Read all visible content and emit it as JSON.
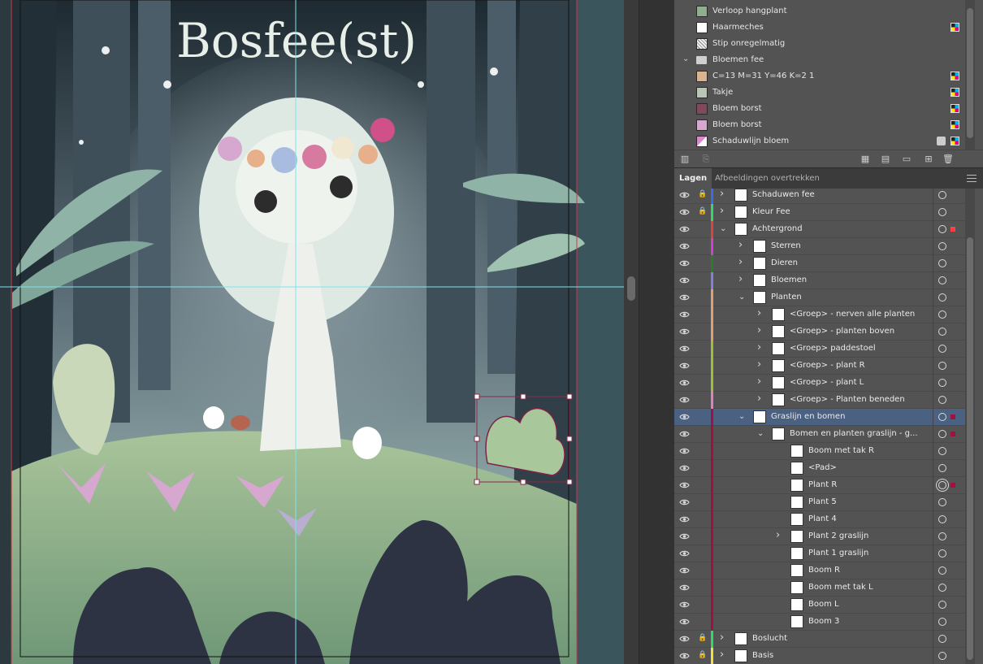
{
  "canvas": {
    "title_text": "Bosfee(st)"
  },
  "swatches": {
    "items": [
      {
        "label": "Verloop hangplant",
        "color": "#8fae8f",
        "kind": "swatch",
        "cmyk": false
      },
      {
        "label": "Haarmeches",
        "color": "#ffffff",
        "kind": "swatch",
        "cmyk": true
      },
      {
        "label": "Stip onregelmatig",
        "color": "#eeeeee",
        "kind": "pattern",
        "cmyk": false
      },
      {
        "label": "Bloemen fee",
        "kind": "folder"
      },
      {
        "label": "C=13 M=31 Y=46 K=2 1",
        "color": "#d9b48f",
        "kind": "swatch",
        "cmyk": true
      },
      {
        "label": "Takje",
        "color": "#b8c6b8",
        "kind": "swatch",
        "cmyk": true
      },
      {
        "label": "Bloem borst",
        "color": "#7d4b5c",
        "kind": "swatch",
        "cmyk": true
      },
      {
        "label": "Bloem borst",
        "color": "#d6a8d0",
        "kind": "swatch",
        "cmyk": true
      },
      {
        "label": "Schaduwlijn bloem",
        "color": "#d68cc6",
        "kind": "swatch",
        "cmyk": true
      }
    ]
  },
  "layers_panel": {
    "tabs": [
      "Lagen",
      "Afbeeldingen overtrekken"
    ],
    "rows": [
      {
        "label": "Schaduwen fee",
        "color": "#3b6de0",
        "indent": 0,
        "expand": "collapsed",
        "locked": true
      },
      {
        "label": "Kleur Fee",
        "color": "#2fd96a",
        "indent": 0,
        "expand": "collapsed",
        "locked": true
      },
      {
        "label": "Achtergrond",
        "color": "#e04040",
        "indent": 0,
        "expand": "expanded",
        "locked": false,
        "sel": "#ff4040"
      },
      {
        "label": "Sterren",
        "color": "#d040d0",
        "indent": 1,
        "expand": "collapsed"
      },
      {
        "label": "Dieren",
        "color": "#2d7a2d",
        "indent": 1,
        "expand": "collapsed"
      },
      {
        "label": "Bloemen",
        "color": "#8080e0",
        "indent": 1,
        "expand": "collapsed"
      },
      {
        "label": "Planten",
        "color": "#e0a070",
        "indent": 1,
        "expand": "expanded"
      },
      {
        "label": "<Groep> - nerven alle planten",
        "color": "#e0a070",
        "indent": 2,
        "expand": "collapsed"
      },
      {
        "label": "<Groep> - planten boven",
        "color": "#e0a070",
        "indent": 2,
        "expand": "collapsed"
      },
      {
        "label": "<Groep> paddestoel",
        "color": "#a0c030",
        "indent": 2,
        "expand": "collapsed"
      },
      {
        "label": "<Groep> - plant R",
        "color": "#a0c030",
        "indent": 2,
        "expand": "collapsed"
      },
      {
        "label": "<Groep> - plant L",
        "color": "#a0c030",
        "indent": 2,
        "expand": "collapsed"
      },
      {
        "label": "<Groep> - Planten beneden",
        "color": "#e080c0",
        "indent": 2,
        "expand": "collapsed"
      },
      {
        "label": "Graslijn en bomen",
        "color": "#a01040",
        "indent": 1,
        "expand": "expanded",
        "selected": true,
        "sel": "#a01040"
      },
      {
        "label": "Bomen en planten graslijn - g...",
        "color": "#a01040",
        "indent": 2,
        "expand": "expanded",
        "sel": "#a01040"
      },
      {
        "label": "Boom met tak R",
        "color": "#a01040",
        "indent": 3,
        "expand": "none"
      },
      {
        "label": "<Pad>",
        "color": "#a01040",
        "indent": 3,
        "expand": "none"
      },
      {
        "label": "Plant R",
        "color": "#a01040",
        "indent": 3,
        "expand": "none",
        "dbl": true,
        "sel": "#a01040"
      },
      {
        "label": "Plant 5",
        "color": "#a01040",
        "indent": 3,
        "expand": "none"
      },
      {
        "label": "Plant 4",
        "color": "#a01040",
        "indent": 3,
        "expand": "none"
      },
      {
        "label": "Plant 2 graslijn",
        "color": "#a01040",
        "indent": 3,
        "expand": "collapsed"
      },
      {
        "label": "Plant 1 graslijn",
        "color": "#a01040",
        "indent": 3,
        "expand": "none"
      },
      {
        "label": "Boom R",
        "color": "#a01040",
        "indent": 3,
        "expand": "none"
      },
      {
        "label": "Boom met tak L",
        "color": "#a01040",
        "indent": 3,
        "expand": "none"
      },
      {
        "label": "Boom L",
        "color": "#a01040",
        "indent": 3,
        "expand": "none"
      },
      {
        "label": "Boom 3",
        "color": "#a01040",
        "indent": 3,
        "expand": "none"
      },
      {
        "label": "Boslucht",
        "color": "#2fd96a",
        "indent": 0,
        "expand": "collapsed",
        "locked": true
      },
      {
        "label": "Basis",
        "color": "#f0e040",
        "indent": 0,
        "expand": "collapsed",
        "locked": true
      }
    ]
  },
  "icons": {
    "eye": "eye-icon",
    "lock": "lock-icon",
    "chevron": "chevron-icon",
    "new-layer": "new-layer-icon",
    "delete": "trash-icon",
    "folder": "folder-icon"
  }
}
